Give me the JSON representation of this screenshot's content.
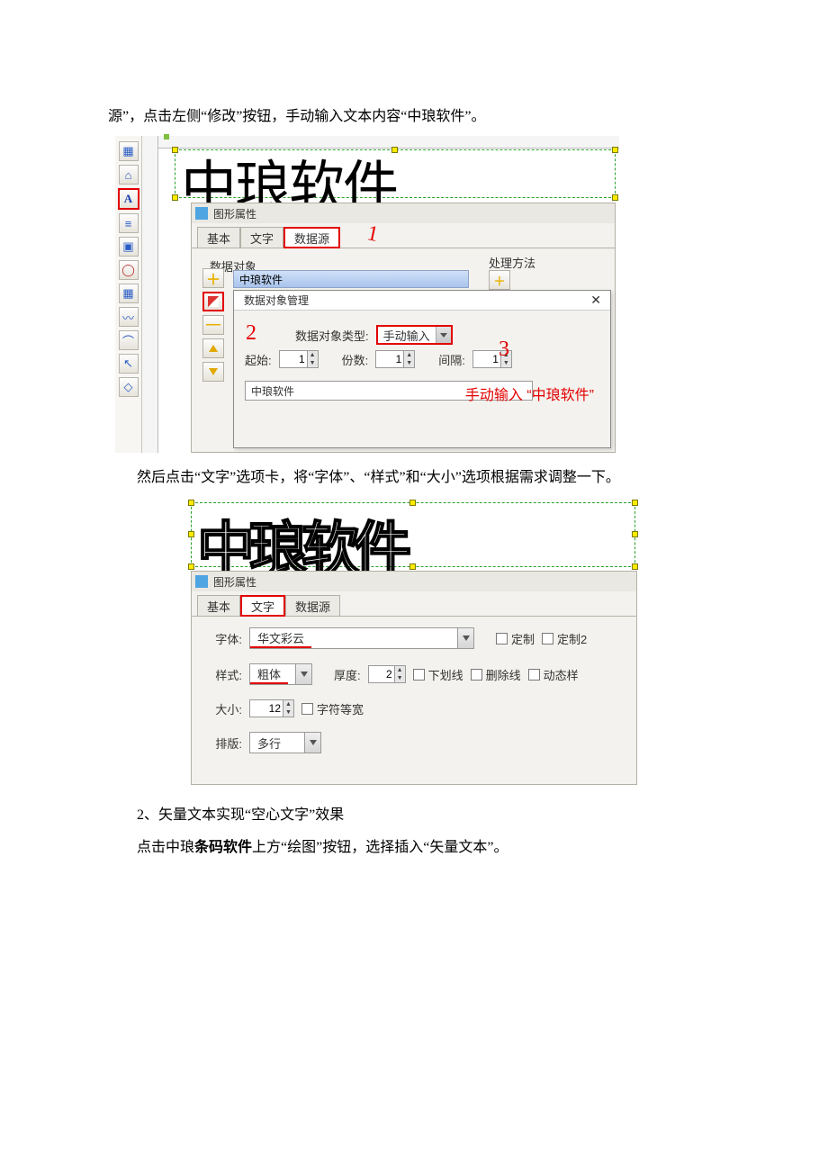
{
  "para1": "源”，点击左侧“修改”按钮，手动输入文本内容“中琅软件”。",
  "shot1": {
    "toolbar_icons": [
      "▦",
      "⌂",
      "A",
      "≡",
      "▣",
      "◯",
      "▦",
      "〰",
      "⌒",
      "↖",
      "◇"
    ],
    "big_text": "中琅软件",
    "panel_title": "图形属性",
    "tabs": {
      "basic": "基本",
      "text": "文字",
      "data": "数据源"
    },
    "group_data_obj": "数据对象",
    "group_proc": "处理方法",
    "list_item": "中琅软件",
    "ann1": "1",
    "ann2": "2",
    "ann3": "3",
    "dialog": {
      "title": "数据对象管理",
      "type_label": "数据对象类型:",
      "type_value": "手动输入",
      "start_label": "起始:",
      "start_value": "1",
      "count_label": "份数:",
      "count_value": "1",
      "gap_label": "间隔:",
      "gap_value": "1",
      "input_value": "中琅软件",
      "red_note": "手动输入 “中琅软件”"
    }
  },
  "para2": "然后点击“文字”选项卡，将“字体”、“样式”和“大小”选项根据需求调整一下。",
  "shot2": {
    "outline_text": "中琅软件",
    "panel_title": "图形属性",
    "tabs": {
      "basic": "基本",
      "text": "文字",
      "data": "数据源"
    },
    "font_label": "字体:",
    "font_value": "华文彩云",
    "custom1": "定制",
    "custom2": "定制2",
    "style_label": "样式:",
    "style_value": "粗体",
    "thick_label": "厚度:",
    "thick_value": "2",
    "underline": "下划线",
    "strike": "删除线",
    "dyn": "动态样",
    "size_label": "大小:",
    "size_value": "12",
    "monow": "字符等宽",
    "layout_label": "排版:",
    "layout_value": "多行"
  },
  "para3a": "2、矢量文本实现“空心文字”效果",
  "para3b_pre": "点击中琅",
  "para3b_bold": "条码软件",
  "para3b_post": "上方“绘图”按钮，选择插入“矢量文本”。"
}
